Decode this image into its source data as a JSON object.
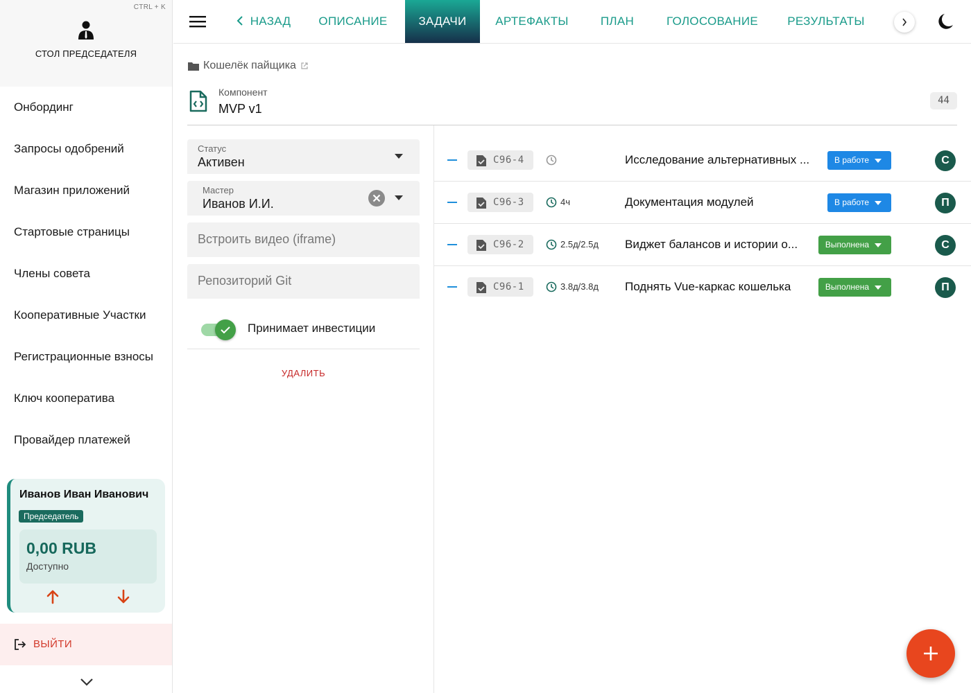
{
  "sidebar": {
    "shortcut": "CTRL + K",
    "title": "СТОЛ ПРЕДСЕДАТЕЛЯ",
    "items": [
      {
        "label": "Онбординг"
      },
      {
        "label": "Запросы одобрений"
      },
      {
        "label": "Магазин приложений"
      },
      {
        "label": "Стартовые страницы"
      },
      {
        "label": "Члены совета"
      },
      {
        "label": "Кооперативные Участки"
      },
      {
        "label": "Регистрационные взносы"
      },
      {
        "label": "Ключ кооператива"
      },
      {
        "label": "Провайдер платежей"
      }
    ],
    "user": {
      "name": "Иванов Иван Иванович",
      "role": "Председатель",
      "balance": "0,00 RUB",
      "balance_label": "Доступно"
    },
    "logout_label": "ВЫЙТИ"
  },
  "topbar": {
    "tabs": [
      {
        "label": "НАЗАД"
      },
      {
        "label": "ОПИСАНИЕ"
      },
      {
        "label": "ЗАДАЧИ"
      },
      {
        "label": "АРТЕФАКТЫ"
      },
      {
        "label": "ПЛАН"
      },
      {
        "label": "ГОЛОСОВАНИЕ"
      },
      {
        "label": "РЕЗУЛЬТАТЫ"
      }
    ],
    "active_tab": "ЗАДАЧИ"
  },
  "breadcrumb": {
    "project": "Кошелёк пайщика"
  },
  "component": {
    "label": "Компонент",
    "name": "MVP v1",
    "count": "44"
  },
  "form": {
    "status": {
      "label": "Статус",
      "value": "Активен"
    },
    "master": {
      "label": "Мастер",
      "value": "Иванов И.И."
    },
    "video_placeholder": "Встроить видео (iframe)",
    "git_placeholder": "Репозиторий Git",
    "invest_toggle": {
      "label": "Принимает инвестиции",
      "on": true
    },
    "delete_label": "УДАЛИТЬ"
  },
  "colors": {
    "accent": "#1a9b8a",
    "status_in_progress": "#1e88e5",
    "status_done": "#43a047",
    "fab": "#e8461e",
    "avatar": "#1a5a4c"
  },
  "tasks": [
    {
      "id": "C96-4",
      "time": "",
      "title": "Исследование альтернативных ...",
      "status": "В работе",
      "status_kind": "in_progress",
      "assignee": "С"
    },
    {
      "id": "C96-3",
      "time": "4ч",
      "title": "Документация модулей",
      "status": "В работе",
      "status_kind": "in_progress",
      "assignee": "П"
    },
    {
      "id": "C96-2",
      "time": "2.5д/2.5д",
      "title": "Виджет балансов и истории о...",
      "status": "Выполнена",
      "status_kind": "done",
      "assignee": "С"
    },
    {
      "id": "C96-1",
      "time": "3.8д/3.8д",
      "title": "Поднять Vue-каркас кошелька",
      "status": "Выполнена",
      "status_kind": "done",
      "assignee": "П"
    }
  ]
}
